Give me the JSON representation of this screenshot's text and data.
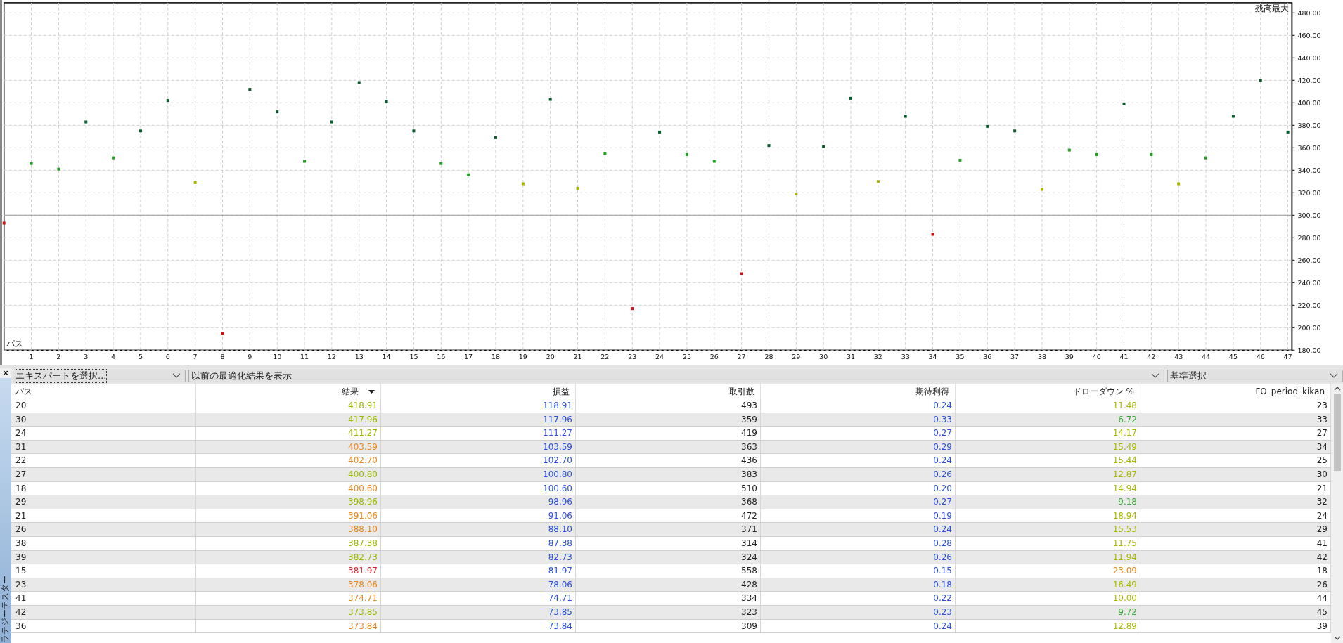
{
  "chart": {
    "chart_data": {
      "type": "scatter",
      "title": "残高最大",
      "xlabel": "パス",
      "x": [
        0,
        1,
        2,
        3,
        4,
        5,
        6,
        7,
        8,
        9,
        10,
        11,
        12,
        13,
        14,
        15,
        16,
        17,
        18,
        19,
        20,
        21,
        22,
        23,
        24,
        25,
        26,
        27,
        28,
        29,
        30,
        31,
        32,
        33,
        34,
        35,
        36,
        37,
        38,
        39,
        40,
        41,
        42,
        43,
        44,
        45,
        46,
        47
      ],
      "values": [
        293,
        346,
        341,
        383,
        351,
        375,
        402,
        329,
        195,
        412,
        392,
        348,
        383,
        418,
        401,
        375,
        346,
        336,
        369,
        328,
        403,
        324,
        355,
        217,
        374,
        354,
        348,
        248,
        362,
        319,
        361,
        404,
        330,
        388,
        283,
        349,
        379,
        375,
        323,
        358,
        354,
        399,
        354,
        328,
        351,
        388,
        420,
        374
      ],
      "xlim": [
        0,
        47.15
      ],
      "ylim": [
        180,
        489
      ],
      "grid": true,
      "ref_lines": [
        {
          "axis": "y",
          "value": 300
        }
      ],
      "xticks": [
        1,
        2,
        3,
        4,
        5,
        6,
        7,
        8,
        9,
        10,
        11,
        12,
        13,
        14,
        15,
        16,
        17,
        18,
        19,
        20,
        21,
        22,
        23,
        24,
        25,
        26,
        27,
        28,
        29,
        30,
        31,
        32,
        33,
        34,
        35,
        36,
        37,
        38,
        39,
        40,
        41,
        42,
        43,
        44,
        45,
        46,
        47
      ],
      "yticks": [
        {
          "value": 180,
          "label": "180.00"
        },
        {
          "value": 200,
          "label": "200.00"
        },
        {
          "value": 220,
          "label": "220.00"
        },
        {
          "value": 240,
          "label": "240.00"
        },
        {
          "value": 260,
          "label": "260.00"
        },
        {
          "value": 280,
          "label": "280.00"
        },
        {
          "value": 300,
          "label": "300.00"
        },
        {
          "value": 320,
          "label": "320.00"
        },
        {
          "value": 340,
          "label": "340.00"
        },
        {
          "value": 360,
          "label": "360.00"
        },
        {
          "value": 380,
          "label": "380.00"
        },
        {
          "value": 400,
          "label": "400.00"
        },
        {
          "value": 420,
          "label": "420.00"
        },
        {
          "value": 440,
          "label": "440.00"
        },
        {
          "value": 460,
          "label": "460.00"
        },
        {
          "value": 480,
          "label": "480.00"
        }
      ]
    }
  },
  "panel": {
    "title": "ラテジーテスター",
    "close": "×"
  },
  "toolbar": {
    "expert_select": "エキスパートを選択...",
    "previous_results": "以前の最適化結果を表示",
    "criterion_select": "基準選択"
  },
  "table": {
    "columns": [
      {
        "label": "パス",
        "sorted": false
      },
      {
        "label": "結果",
        "sorted": true
      },
      {
        "label": "損益",
        "sorted": false
      },
      {
        "label": "取引数",
        "sorted": false
      },
      {
        "label": "期待利得",
        "sorted": false
      },
      {
        "label": "ドローダウン %",
        "sorted": false
      },
      {
        "label": "FO_period_kikan",
        "sorted": false
      }
    ],
    "rows": [
      {
        "pass": "20",
        "result": {
          "text": "418.91",
          "color": "#9cb800"
        },
        "profit": "118.91",
        "trades": "493",
        "expected": "0.24",
        "drawdown": {
          "text": "11.48",
          "color": "#a8b800"
        },
        "fo": "23"
      },
      {
        "pass": "30",
        "result": {
          "text": "417.96",
          "color": "#9cb800"
        },
        "profit": "117.96",
        "trades": "359",
        "expected": "0.33",
        "drawdown": {
          "text": "6.72",
          "color": "#38a838"
        },
        "fo": "33"
      },
      {
        "pass": "24",
        "result": {
          "text": "411.27",
          "color": "#9cb800"
        },
        "profit": "111.27",
        "trades": "419",
        "expected": "0.27",
        "drawdown": {
          "text": "14.17",
          "color": "#a8b800"
        },
        "fo": "27"
      },
      {
        "pass": "31",
        "result": {
          "text": "403.59",
          "color": "#e8871e"
        },
        "profit": "103.59",
        "trades": "363",
        "expected": "0.29",
        "drawdown": {
          "text": "15.49",
          "color": "#a8b800"
        },
        "fo": "34"
      },
      {
        "pass": "22",
        "result": {
          "text": "402.70",
          "color": "#e8871e"
        },
        "profit": "102.70",
        "trades": "436",
        "expected": "0.24",
        "drawdown": {
          "text": "15.44",
          "color": "#a8b800"
        },
        "fo": "25"
      },
      {
        "pass": "27",
        "result": {
          "text": "400.80",
          "color": "#9cb800"
        },
        "profit": "100.80",
        "trades": "383",
        "expected": "0.26",
        "drawdown": {
          "text": "12.87",
          "color": "#a8b800"
        },
        "fo": "30"
      },
      {
        "pass": "18",
        "result": {
          "text": "400.60",
          "color": "#e8871e"
        },
        "profit": "100.60",
        "trades": "510",
        "expected": "0.20",
        "drawdown": {
          "text": "14.94",
          "color": "#a8b800"
        },
        "fo": "21"
      },
      {
        "pass": "29",
        "result": {
          "text": "398.96",
          "color": "#9cb800"
        },
        "profit": "98.96",
        "trades": "368",
        "expected": "0.27",
        "drawdown": {
          "text": "9.18",
          "color": "#38a838"
        },
        "fo": "32"
      },
      {
        "pass": "21",
        "result": {
          "text": "391.06",
          "color": "#e8871e"
        },
        "profit": "91.06",
        "trades": "472",
        "expected": "0.19",
        "drawdown": {
          "text": "18.94",
          "color": "#a8b800"
        },
        "fo": "24"
      },
      {
        "pass": "26",
        "result": {
          "text": "388.10",
          "color": "#e8871e"
        },
        "profit": "88.10",
        "trades": "371",
        "expected": "0.24",
        "drawdown": {
          "text": "15.53",
          "color": "#a8b800"
        },
        "fo": "29"
      },
      {
        "pass": "38",
        "result": {
          "text": "387.38",
          "color": "#9cb800"
        },
        "profit": "87.38",
        "trades": "314",
        "expected": "0.28",
        "drawdown": {
          "text": "11.75",
          "color": "#a8b800"
        },
        "fo": "41"
      },
      {
        "pass": "39",
        "result": {
          "text": "382.73",
          "color": "#9cb800"
        },
        "profit": "82.73",
        "trades": "324",
        "expected": "0.26",
        "drawdown": {
          "text": "11.94",
          "color": "#a8b800"
        },
        "fo": "42"
      },
      {
        "pass": "15",
        "result": {
          "text": "381.97",
          "color": "#d8202a"
        },
        "profit": "81.97",
        "trades": "558",
        "expected": "0.15",
        "drawdown": {
          "text": "23.09",
          "color": "#e8871e"
        },
        "fo": "18"
      },
      {
        "pass": "23",
        "result": {
          "text": "378.06",
          "color": "#e8871e"
        },
        "profit": "78.06",
        "trades": "428",
        "expected": "0.18",
        "drawdown": {
          "text": "16.49",
          "color": "#a8b800"
        },
        "fo": "26"
      },
      {
        "pass": "41",
        "result": {
          "text": "374.71",
          "color": "#e8871e"
        },
        "profit": "74.71",
        "trades": "334",
        "expected": "0.22",
        "drawdown": {
          "text": "10.00",
          "color": "#a8b800"
        },
        "fo": "44"
      },
      {
        "pass": "42",
        "result": {
          "text": "373.85",
          "color": "#9cb800"
        },
        "profit": "73.85",
        "trades": "323",
        "expected": "0.23",
        "drawdown": {
          "text": "9.72",
          "color": "#38a838"
        },
        "fo": "45"
      },
      {
        "pass": "36",
        "result": {
          "text": "373.84",
          "color": "#e8871e"
        },
        "profit": "73.84",
        "trades": "309",
        "expected": "0.24",
        "drawdown": {
          "text": "12.89",
          "color": "#a8b800"
        },
        "fo": "39"
      }
    ]
  }
}
